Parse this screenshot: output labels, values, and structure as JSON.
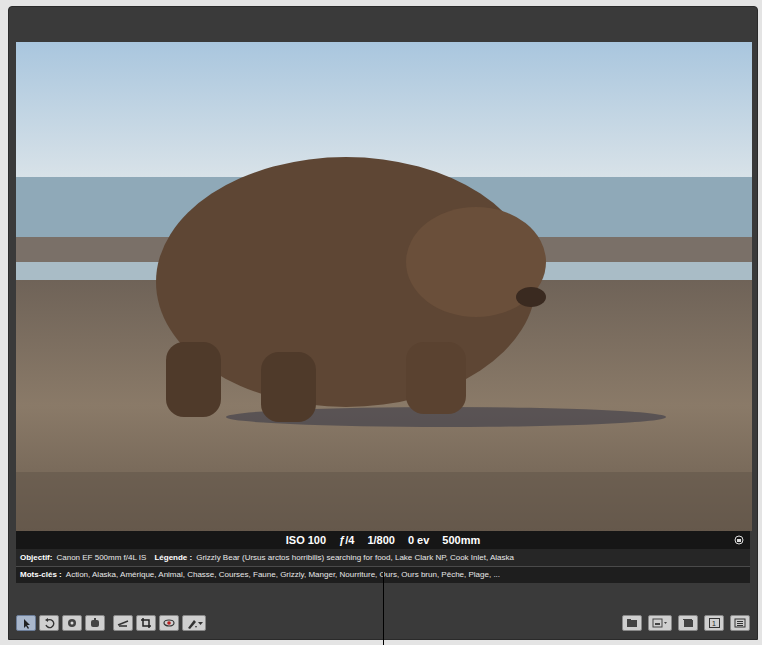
{
  "viewer": {
    "exif": [
      "ISO 100",
      "ƒ/4",
      "1/800",
      "0 ev",
      "500mm"
    ],
    "lens": {
      "label": "Objectif:",
      "value": "Canon EF 500mm f/4L IS"
    },
    "caption": {
      "label": "Légende :",
      "value": "Grizzly Bear (Ursus arctos horribilis) searching for food, Lake Clark NP, Cook Inlet, Alaska"
    },
    "keywords": {
      "label": "Mots-clés :",
      "value": "Action, Alaska, Amérique, Animal, Chasse, Courses, Faune, Grizzly, Manger, Nourriture, Ours, Ours brun, Pêche, Plage, ..."
    }
  },
  "toolbar": {
    "tools": [
      {
        "selected": true
      },
      {
        "selected": false
      },
      {
        "selected": false
      },
      {
        "selected": false
      },
      {
        "selected": false
      },
      {
        "selected": false
      },
      {
        "selected": false
      },
      {
        "selected": false
      }
    ],
    "view_button_label": "1"
  }
}
